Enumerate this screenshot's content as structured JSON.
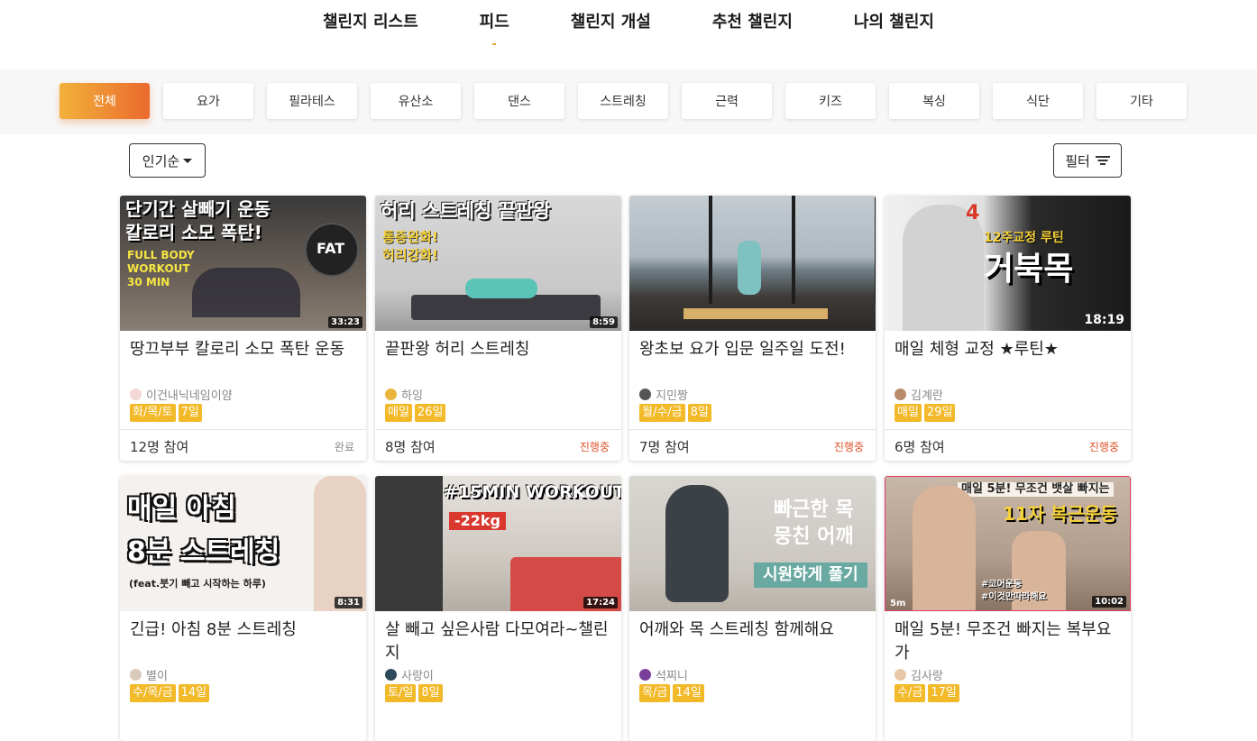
{
  "nav": {
    "items": [
      "챌린지 리스트",
      "피드",
      "챌린지 개설",
      "추천 챌린지",
      "나의 챌린지"
    ],
    "active_index": 1
  },
  "categories": {
    "items": [
      "전체",
      "요가",
      "필라테스",
      "유산소",
      "댄스",
      "스트레칭",
      "근력",
      "키즈",
      "복싱",
      "식단",
      "기타"
    ],
    "active_index": 0
  },
  "sort": {
    "label": "인기순",
    "icon": "caret-down-icon"
  },
  "filter": {
    "label": "필터",
    "icon": "filter-icon"
  },
  "colors": {
    "accent_start": "#f2b13a",
    "accent_end": "#ea6a2e",
    "tag": "#f2b928",
    "in_progress": "#e0522a",
    "done": "#888888"
  },
  "cards": [
    {
      "overlay_lines": [
        "단기간 살빼기 운동",
        "칼로리 소모 폭탄!"
      ],
      "overlay_sub": [
        "FULL BODY",
        "WORKOUT",
        "30 MIN"
      ],
      "badge": "FAT",
      "duration": "33:23",
      "title": "땅끄부부 칼로리 소모 폭탄 운동",
      "author": "이건내닉네임이얌",
      "days": "화/목/토",
      "length": "7일",
      "count": "12명 참여",
      "status": "완료"
    },
    {
      "overlay_lines": [
        "허리 스트레칭 끝판왕"
      ],
      "overlay_sub": [
        "통증완화!",
        "허리강화!"
      ],
      "badge": "",
      "duration": "8:59",
      "title": "끝판왕 허리 스트레칭",
      "author": "하잉",
      "days": "매일",
      "length": "26일",
      "count": "8명 참여",
      "status": "진행중"
    },
    {
      "overlay_lines": [],
      "overlay_sub": [],
      "badge": "",
      "duration": "",
      "title": "왕초보 요가 입문 일주일 도전!",
      "author": "지민짱",
      "days": "월/수/금",
      "length": "8일",
      "count": "7명 참여",
      "status": "진행중"
    },
    {
      "overlay_lines": [
        "거북목"
      ],
      "overlay_sub": [
        "12주교정 루틴"
      ],
      "badge": "4",
      "duration": "18:19",
      "title": "매일 체형 교정 ★루틴★",
      "author": "김계란",
      "days": "매일",
      "length": "29일",
      "count": "6명 참여",
      "status": "진행중"
    },
    {
      "overlay_lines": [
        "매일 아침",
        "8분 스트레칭"
      ],
      "overlay_sub": [
        "(feat.붓기 빼고 시작하는 하루)"
      ],
      "badge": "",
      "duration": "8:31",
      "title": "긴급! 아침 8분 스트레칭",
      "author": "별이",
      "days": "수/목/금",
      "length": "14일",
      "count": "",
      "status": ""
    },
    {
      "overlay_lines": [
        "#15MIN WORKOUT"
      ],
      "overlay_sub": [
        "-22kg"
      ],
      "badge": "",
      "duration": "17:24",
      "title": "살 빼고 싶은사람 다모여라~챌린지",
      "author": "사랑이",
      "days": "토/일",
      "length": "8일",
      "count": "",
      "status": ""
    },
    {
      "overlay_lines": [
        "빠근한 목",
        "뭉친 어깨"
      ],
      "overlay_sub": [
        "시원하게 풀기"
      ],
      "badge": "",
      "duration": "",
      "title": "어깨와 목 스트레칭 함께해요",
      "author": "석찌니",
      "days": "목/금",
      "length": "14일",
      "count": "",
      "status": ""
    },
    {
      "overlay_lines": [
        "매일 5분! 무조건 뱃살 빠지는",
        "11자 복근운동"
      ],
      "overlay_sub": [
        "#코어운동",
        "#이것만따라해요"
      ],
      "badge": "5m",
      "duration": "10:02",
      "title": "매일 5분! 무조건 빠지는 복부요가",
      "author": "김사랑",
      "days": "수/금",
      "length": "17일",
      "count": "",
      "status": ""
    }
  ]
}
